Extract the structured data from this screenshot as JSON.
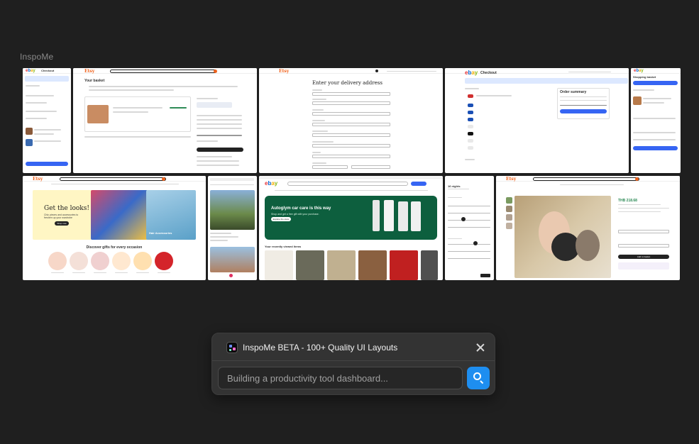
{
  "brand": {
    "name": "InspoMe"
  },
  "gallery": {
    "tiles": [
      {
        "logo": "ebay",
        "title": "Checkout"
      },
      {
        "logo": "Etsy",
        "title": "Your basket",
        "button": "Proceed to checkout"
      },
      {
        "logo": "Etsy",
        "title": "Enter your delivery address"
      },
      {
        "logo": "ebay",
        "title": "Checkout",
        "section": "Order summary",
        "button": "Confirm and pay"
      },
      {
        "logo": "ebay",
        "title": "Shopping basket",
        "button": "Go to checkout"
      },
      {
        "logo": "Etsy",
        "headline": "Get the looks!",
        "subtitle": "Chic pieces and accessories to freshen up your wardrobe",
        "button": "Shop now",
        "side_label": "Hair Accessories",
        "section": "Discover gifts for every occasion"
      },
      {
        "logo": "",
        "title": "Product list"
      },
      {
        "logo": "ebay",
        "headline": "Autoglym car care is this way",
        "subtitle": "Shop and get a free gift with your purchase.",
        "button": "Explore the store",
        "section": "Your recently viewed items"
      },
      {
        "logo": "",
        "title": "16 nights"
      },
      {
        "logo": "Etsy",
        "price": "THB 218.68",
        "button": "Add to basket"
      }
    ]
  },
  "search_panel": {
    "title": "InspoMe BETA - 100+ Quality UI Layouts",
    "placeholder": "Building a productivity tool dashboard...",
    "colors": {
      "panel_bg": "#333333",
      "accent": "#1e8ef0",
      "page_bg": "#1f1f1f"
    }
  }
}
